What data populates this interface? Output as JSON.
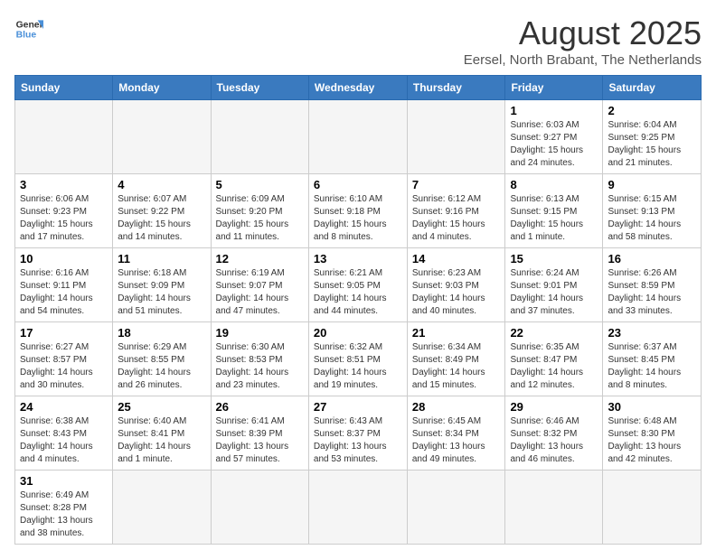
{
  "header": {
    "logo_general": "General",
    "logo_blue": "Blue",
    "title": "August 2025",
    "subtitle": "Eersel, North Brabant, The Netherlands"
  },
  "weekdays": [
    "Sunday",
    "Monday",
    "Tuesday",
    "Wednesday",
    "Thursday",
    "Friday",
    "Saturday"
  ],
  "weeks": [
    [
      {
        "day": "",
        "info": ""
      },
      {
        "day": "",
        "info": ""
      },
      {
        "day": "",
        "info": ""
      },
      {
        "day": "",
        "info": ""
      },
      {
        "day": "",
        "info": ""
      },
      {
        "day": "1",
        "info": "Sunrise: 6:03 AM\nSunset: 9:27 PM\nDaylight: 15 hours and 24 minutes."
      },
      {
        "day": "2",
        "info": "Sunrise: 6:04 AM\nSunset: 9:25 PM\nDaylight: 15 hours and 21 minutes."
      }
    ],
    [
      {
        "day": "3",
        "info": "Sunrise: 6:06 AM\nSunset: 9:23 PM\nDaylight: 15 hours and 17 minutes."
      },
      {
        "day": "4",
        "info": "Sunrise: 6:07 AM\nSunset: 9:22 PM\nDaylight: 15 hours and 14 minutes."
      },
      {
        "day": "5",
        "info": "Sunrise: 6:09 AM\nSunset: 9:20 PM\nDaylight: 15 hours and 11 minutes."
      },
      {
        "day": "6",
        "info": "Sunrise: 6:10 AM\nSunset: 9:18 PM\nDaylight: 15 hours and 8 minutes."
      },
      {
        "day": "7",
        "info": "Sunrise: 6:12 AM\nSunset: 9:16 PM\nDaylight: 15 hours and 4 minutes."
      },
      {
        "day": "8",
        "info": "Sunrise: 6:13 AM\nSunset: 9:15 PM\nDaylight: 15 hours and 1 minute."
      },
      {
        "day": "9",
        "info": "Sunrise: 6:15 AM\nSunset: 9:13 PM\nDaylight: 14 hours and 58 minutes."
      }
    ],
    [
      {
        "day": "10",
        "info": "Sunrise: 6:16 AM\nSunset: 9:11 PM\nDaylight: 14 hours and 54 minutes."
      },
      {
        "day": "11",
        "info": "Sunrise: 6:18 AM\nSunset: 9:09 PM\nDaylight: 14 hours and 51 minutes."
      },
      {
        "day": "12",
        "info": "Sunrise: 6:19 AM\nSunset: 9:07 PM\nDaylight: 14 hours and 47 minutes."
      },
      {
        "day": "13",
        "info": "Sunrise: 6:21 AM\nSunset: 9:05 PM\nDaylight: 14 hours and 44 minutes."
      },
      {
        "day": "14",
        "info": "Sunrise: 6:23 AM\nSunset: 9:03 PM\nDaylight: 14 hours and 40 minutes."
      },
      {
        "day": "15",
        "info": "Sunrise: 6:24 AM\nSunset: 9:01 PM\nDaylight: 14 hours and 37 minutes."
      },
      {
        "day": "16",
        "info": "Sunrise: 6:26 AM\nSunset: 8:59 PM\nDaylight: 14 hours and 33 minutes."
      }
    ],
    [
      {
        "day": "17",
        "info": "Sunrise: 6:27 AM\nSunset: 8:57 PM\nDaylight: 14 hours and 30 minutes."
      },
      {
        "day": "18",
        "info": "Sunrise: 6:29 AM\nSunset: 8:55 PM\nDaylight: 14 hours and 26 minutes."
      },
      {
        "day": "19",
        "info": "Sunrise: 6:30 AM\nSunset: 8:53 PM\nDaylight: 14 hours and 23 minutes."
      },
      {
        "day": "20",
        "info": "Sunrise: 6:32 AM\nSunset: 8:51 PM\nDaylight: 14 hours and 19 minutes."
      },
      {
        "day": "21",
        "info": "Sunrise: 6:34 AM\nSunset: 8:49 PM\nDaylight: 14 hours and 15 minutes."
      },
      {
        "day": "22",
        "info": "Sunrise: 6:35 AM\nSunset: 8:47 PM\nDaylight: 14 hours and 12 minutes."
      },
      {
        "day": "23",
        "info": "Sunrise: 6:37 AM\nSunset: 8:45 PM\nDaylight: 14 hours and 8 minutes."
      }
    ],
    [
      {
        "day": "24",
        "info": "Sunrise: 6:38 AM\nSunset: 8:43 PM\nDaylight: 14 hours and 4 minutes."
      },
      {
        "day": "25",
        "info": "Sunrise: 6:40 AM\nSunset: 8:41 PM\nDaylight: 14 hours and 1 minute."
      },
      {
        "day": "26",
        "info": "Sunrise: 6:41 AM\nSunset: 8:39 PM\nDaylight: 13 hours and 57 minutes."
      },
      {
        "day": "27",
        "info": "Sunrise: 6:43 AM\nSunset: 8:37 PM\nDaylight: 13 hours and 53 minutes."
      },
      {
        "day": "28",
        "info": "Sunrise: 6:45 AM\nSunset: 8:34 PM\nDaylight: 13 hours and 49 minutes."
      },
      {
        "day": "29",
        "info": "Sunrise: 6:46 AM\nSunset: 8:32 PM\nDaylight: 13 hours and 46 minutes."
      },
      {
        "day": "30",
        "info": "Sunrise: 6:48 AM\nSunset: 8:30 PM\nDaylight: 13 hours and 42 minutes."
      }
    ],
    [
      {
        "day": "31",
        "info": "Sunrise: 6:49 AM\nSunset: 8:28 PM\nDaylight: 13 hours and 38 minutes."
      },
      {
        "day": "",
        "info": ""
      },
      {
        "day": "",
        "info": ""
      },
      {
        "day": "",
        "info": ""
      },
      {
        "day": "",
        "info": ""
      },
      {
        "day": "",
        "info": ""
      },
      {
        "day": "",
        "info": ""
      }
    ]
  ]
}
